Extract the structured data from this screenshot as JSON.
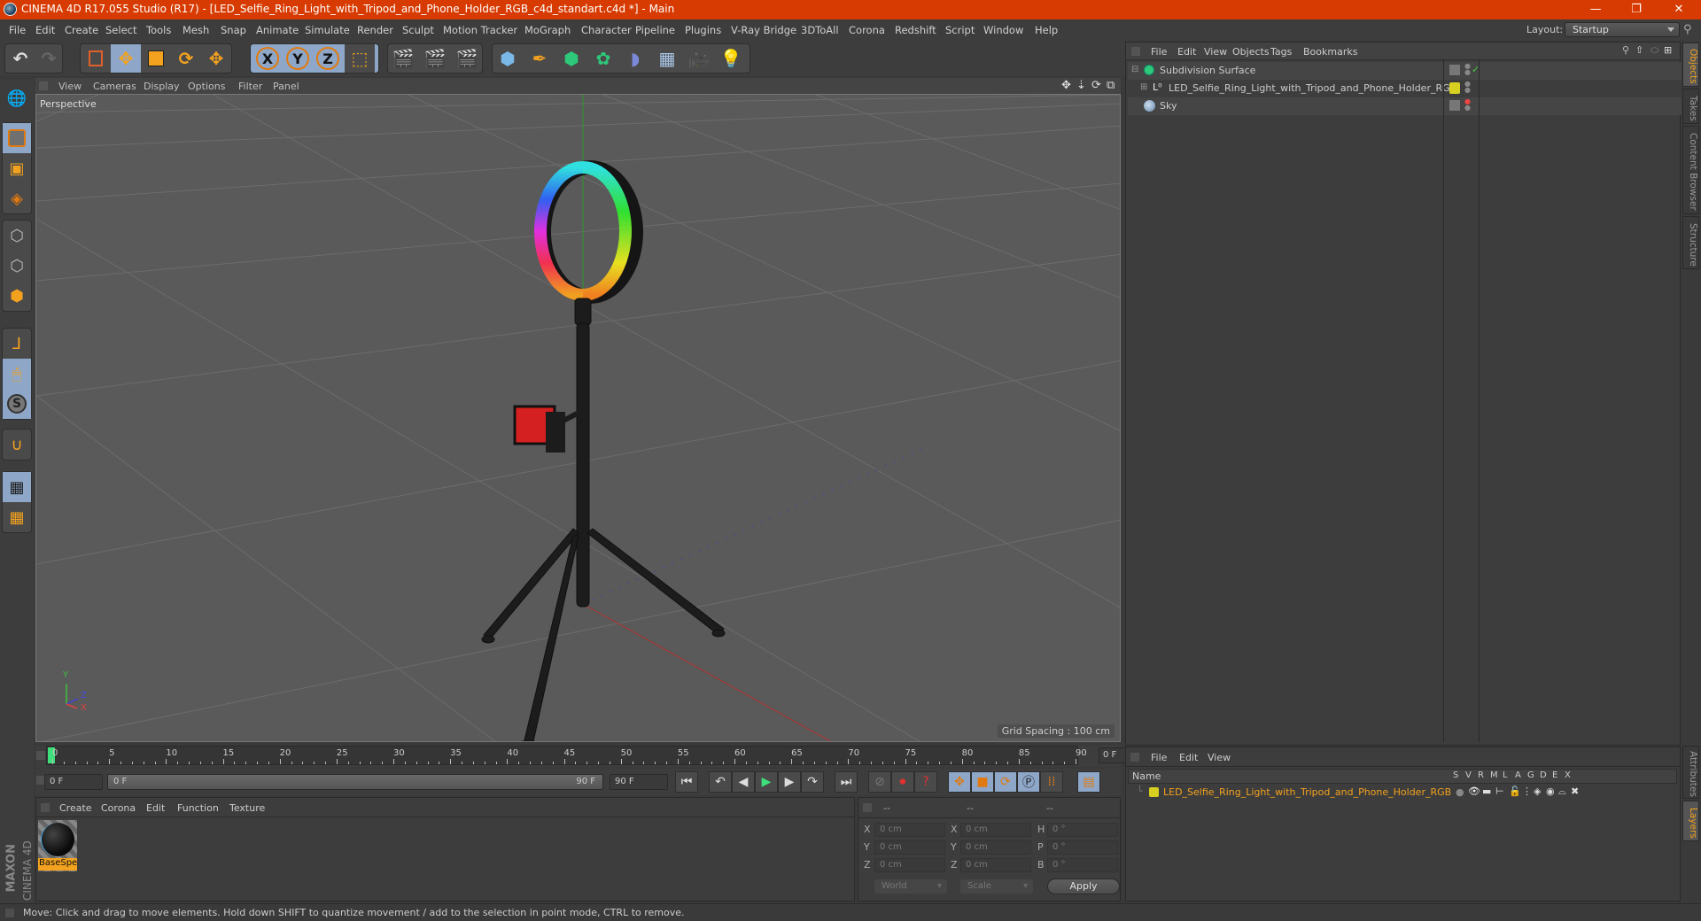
{
  "window": {
    "title": "CINEMA 4D R17.055 Studio (R17) - [LED_Selfie_Ring_Light_with_Tripod_and_Phone_Holder_RGB_c4d_standart.c4d *] - Main",
    "minimize": "—",
    "restore": "❐",
    "close": "✕"
  },
  "menubar": {
    "items": [
      "File",
      "Edit",
      "Create",
      "Select",
      "Tools",
      "Mesh",
      "Snap",
      "Animate",
      "Simulate",
      "Render",
      "Sculpt",
      "Motion Tracker",
      "MoGraph",
      "Character",
      "Pipeline",
      "Plugins",
      "V-Ray Bridge",
      "3DToAll",
      "Corona",
      "Redshift",
      "Script",
      "Window",
      "Help"
    ],
    "layout_label": "Layout:",
    "layout_value": "Startup"
  },
  "toolbar": {
    "axis_x": "X",
    "axis_y": "Y",
    "axis_z": "Z"
  },
  "viewport": {
    "menu": [
      "View",
      "Cameras",
      "Display",
      "Options",
      "Filter",
      "Panel"
    ],
    "camera_label": "Perspective",
    "grid_spacing": "Grid Spacing : 100 cm",
    "axis_labels": {
      "x": "X",
      "y": "Y",
      "z": "Z"
    }
  },
  "objects_panel": {
    "menu": [
      "File",
      "Edit",
      "View",
      "Objects",
      "Tags",
      "Bookmarks"
    ],
    "items": [
      {
        "name": "Subdivision Surface",
        "icon": "subdivision-surface-icon",
        "check": "✓"
      },
      {
        "name": "LED_Selfie_Ring_Light_with_Tripod_and_Phone_Holder_RGB",
        "icon": "null-object-icon",
        "layer_color": "#d8d020"
      },
      {
        "name": "Sky",
        "icon": "sky-icon"
      }
    ]
  },
  "side_tabs": {
    "top": [
      "Objects",
      "Takes",
      "Content Browser",
      "Structure"
    ],
    "bottom": [
      "Attributes",
      "Layers"
    ]
  },
  "timeline": {
    "ticks": [
      "0",
      "5",
      "10",
      "15",
      "20",
      "25",
      "30",
      "35",
      "40",
      "45",
      "50",
      "55",
      "60",
      "65",
      "70",
      "75",
      "80",
      "85",
      "90"
    ],
    "current_frame": "0 F",
    "start_field": "0 F",
    "range_start": "0 F",
    "range_end": "90 F",
    "end_field": "90 F"
  },
  "material_panel": {
    "menu": [
      "Create",
      "Corona",
      "Edit",
      "Function",
      "Texture"
    ],
    "materials": [
      {
        "name": "BaseSpe"
      }
    ]
  },
  "coord_panel": {
    "headers": [
      "--",
      "--",
      "--"
    ],
    "rows": [
      {
        "l1": "X",
        "v1": "0 cm",
        "l2": "X",
        "v2": "0 cm",
        "l3": "H",
        "v3": "0 °"
      },
      {
        "l1": "Y",
        "v1": "0 cm",
        "l2": "Y",
        "v2": "0 cm",
        "l3": "P",
        "v3": "0 °"
      },
      {
        "l1": "Z",
        "v1": "0 cm",
        "l2": "Z",
        "v2": "0 cm",
        "l3": "B",
        "v3": "0 °"
      }
    ],
    "mode1": "World",
    "mode2": "Scale",
    "apply": "Apply"
  },
  "layers_panel": {
    "menu": [
      "File",
      "Edit",
      "View"
    ],
    "name_header": "Name",
    "columns": [
      "S",
      "V",
      "R",
      "M",
      "L",
      "A",
      "G",
      "D",
      "E",
      "X"
    ],
    "layers": [
      {
        "name": "LED_Selfie_Ring_Light_with_Tripod_and_Phone_Holder_RGB",
        "color": "#d8d020"
      }
    ]
  },
  "branding": {
    "maxon": "MAXON",
    "product": "CINEMA 4D"
  },
  "status": "Move: Click and drag to move elements. Hold down SHIFT to quantize movement / add to the selection in point mode, CTRL to remove.",
  "colors": {
    "accent": "#f3a21f",
    "titlebar": "#d83b01",
    "active_tool": "#8ea7c8"
  }
}
